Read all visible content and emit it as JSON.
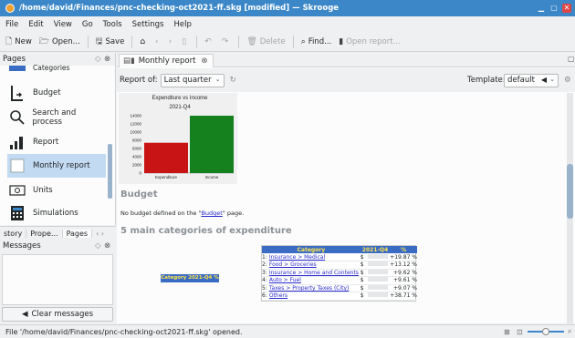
{
  "window": {
    "title": "/home/david/Finances/pnc-checking-oct2021-ff.skg [modified] — Skrooge"
  },
  "menu": [
    "File",
    "Edit",
    "View",
    "Go",
    "Tools",
    "Settings",
    "Help"
  ],
  "toolbar": {
    "new": "New",
    "open": "Open...",
    "save": "Save",
    "delete": "Delete",
    "find": "Find...",
    "open_report": "Open report..."
  },
  "pages_dock": {
    "title": "Pages",
    "items": [
      {
        "label": "Categories"
      },
      {
        "label": "Budget"
      },
      {
        "label": "Search and process"
      },
      {
        "label": "Report"
      },
      {
        "label": "Monthly report"
      },
      {
        "label": "Units"
      },
      {
        "label": "Simulations"
      }
    ]
  },
  "dock_tabs": [
    "story",
    "Prope...",
    "Pages"
  ],
  "messages_dock": {
    "title": "Messages",
    "clear_label": "Clear messages"
  },
  "main": {
    "tab_label": "Monthly report",
    "report_of_label": "Report of:",
    "period_value": "Last quarter",
    "template_label": "Template:",
    "template_value": "default"
  },
  "report": {
    "budget_heading": "Budget",
    "budget_text_before": "No budget defined on the \"",
    "budget_link": "Budget",
    "budget_text_after": "\" page.",
    "categories_heading": "5 main categories of expenditure",
    "mini_chart_label": "Category 2021-Q4 %",
    "table_headers": [
      "Category",
      "2021-Q4",
      "%"
    ],
    "table_rows": [
      {
        "idx": "1:",
        "cat": "Insurance > Medical",
        "cur": "$",
        "pct": "+19.87 %"
      },
      {
        "idx": "2:",
        "cat": "Food > Groceries",
        "cur": "$",
        "pct": "+13.12 %"
      },
      {
        "idx": "3:",
        "cat": "Insurance > Home and Contents",
        "cur": "$",
        "pct": "+9.62 %"
      },
      {
        "idx": "4:",
        "cat": "Auto > Fuel",
        "cur": "$",
        "pct": "+9.61 %"
      },
      {
        "idx": "5:",
        "cat": "Taxes > Property Taxes (City)",
        "cur": "$",
        "pct": "+9.07 %"
      },
      {
        "idx": "6:",
        "cat": "Others",
        "cur": "$",
        "pct": "+38.71 %"
      }
    ]
  },
  "colors": {
    "expenditure": "#c81414",
    "income": "#14801e",
    "titlebar": "#3b87c8",
    "selection": "#c2dbf3"
  },
  "chart_data": {
    "type": "bar",
    "title": "Expenditure vs Income",
    "subtitle": "2021-Q4",
    "categories": [
      "Expenditure",
      "Income"
    ],
    "values": [
      7400,
      14400
    ],
    "yticks": [
      "14000",
      "12000",
      "10000",
      "8000",
      "6000",
      "4000",
      "2000",
      "0"
    ],
    "ylim": [
      0,
      14000
    ]
  },
  "status": {
    "text": "File '/home/david/Finances/pnc-checking-oct2021-ff.skg' opened."
  }
}
